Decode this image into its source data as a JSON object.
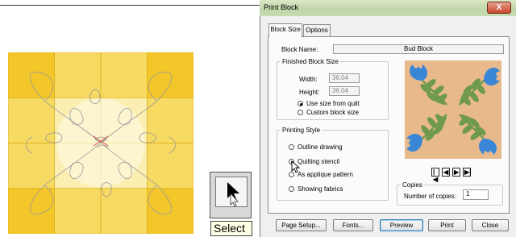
{
  "colors": {
    "quilt_dark": "#f3c629",
    "quilt_mid": "#f7da62",
    "quilt_light": "#fbeeb0",
    "quilt_center": "#fdf8dd",
    "preview_bg": "#e8b98a",
    "leaf": "#6f9a4b",
    "tulip": "#3a86d6",
    "dialog_bg": "#f0f0f0"
  },
  "tool": {
    "icon": "arrow-pointer-icon",
    "tooltip": "Select"
  },
  "dialog": {
    "title": "Print Block",
    "close_label": "X",
    "tabs": [
      {
        "label": "Block Size",
        "active": true
      },
      {
        "label": "Options",
        "active": false
      }
    ],
    "block_name_label": "Block Name:",
    "block_name_value": "Bud Block",
    "finished_size": {
      "title": "Finished Block Size",
      "width_label": "Width:",
      "width_value": "36.04",
      "height_label": "Height:",
      "height_value": "36.04",
      "options": [
        {
          "label": "Use size from quilt",
          "selected": true
        },
        {
          "label": "Custom block size",
          "selected": false
        }
      ]
    },
    "printing_style": {
      "title": "Printing Style",
      "options": [
        {
          "label": "Outline drawing",
          "selected": false
        },
        {
          "label": "Quilting stencil",
          "selected": true
        },
        {
          "label": "As applique pattern",
          "selected": false
        },
        {
          "label": "Showing fabrics",
          "selected": false
        }
      ]
    },
    "nav": {
      "first": "|◀",
      "prev": "◀",
      "next": "▶",
      "last": "▶|"
    },
    "copies": {
      "title": "Copies",
      "label": "Number of copies:",
      "value": "1"
    },
    "buttons": {
      "page_setup": "Page Setup...",
      "fonts": "Fonts...",
      "preview": "Preview",
      "print": "Print",
      "close": "Close"
    }
  }
}
